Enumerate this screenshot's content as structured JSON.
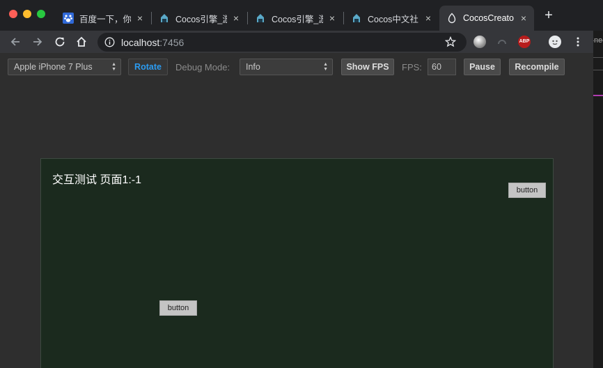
{
  "tabs": [
    {
      "title": "百度一下，你",
      "favicon": "baidu-paw-icon"
    },
    {
      "title": "Cocos引擎_游",
      "favicon": "cocos-logo-icon"
    },
    {
      "title": "Cocos引擎_游",
      "favicon": "cocos-logo-icon"
    },
    {
      "title": "Cocos中文社",
      "favicon": "cocos-logo-icon"
    },
    {
      "title": "CocosCreato",
      "favicon": "cocos-creator-icon",
      "active": true
    }
  ],
  "tab_close_glyph": "×",
  "newtab_glyph": "+",
  "address": {
    "host": "localhost",
    "port": ":7456"
  },
  "extensions": {
    "abp_label": "ABP"
  },
  "edge_text": "ne",
  "preview": {
    "device": "Apple iPhone 7 Plus",
    "rotate_label": "Rotate",
    "debug_mode_label": "Debug Mode:",
    "debug_mode_value": "Info",
    "show_fps_label": "Show FPS",
    "fps_label": "FPS:",
    "fps_value": "60",
    "pause_label": "Pause",
    "recompile_label": "Recompile"
  },
  "game": {
    "title": "交互测试 页面1:-1",
    "button_top_label": "button",
    "button_mid_label": "button"
  },
  "colors": {
    "chrome_frame": "#202124",
    "toolbar": "#35363a",
    "rotate_text": "#2b9bf0",
    "canvas_bg": "#1b2a1e"
  }
}
